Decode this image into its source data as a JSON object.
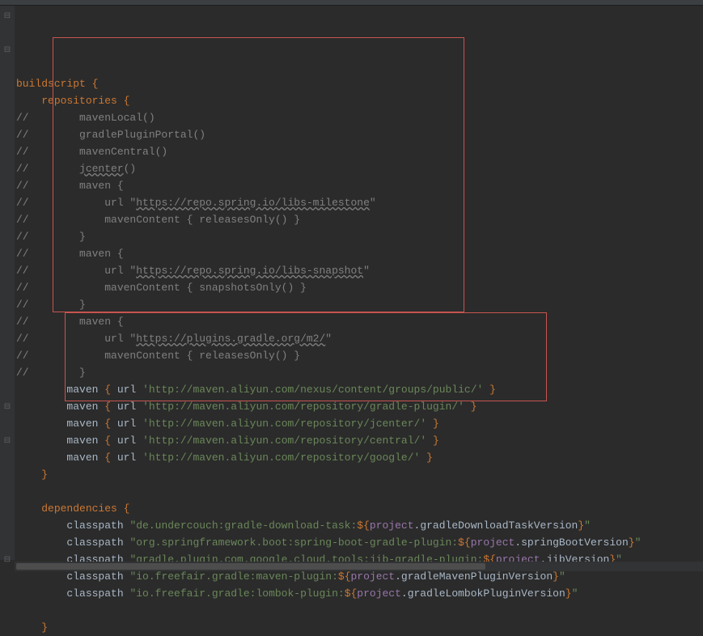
{
  "code": {
    "lines": [
      {
        "t": "code",
        "pre": "",
        "parts": [
          {
            "c": "keyword",
            "v": "buildscript"
          },
          {
            "c": "",
            "v": " "
          },
          {
            "c": "keyword",
            "v": "{"
          }
        ]
      },
      {
        "t": "code",
        "pre": "    ",
        "parts": [
          {
            "c": "keyword",
            "v": "repositories"
          },
          {
            "c": "",
            "v": " "
          },
          {
            "c": "keyword",
            "v": "{"
          }
        ]
      },
      {
        "t": "comment",
        "pre": "//        ",
        "parts": [
          {
            "c": "comment",
            "v": "mavenLocal()"
          }
        ]
      },
      {
        "t": "comment",
        "pre": "//        ",
        "parts": [
          {
            "c": "comment",
            "v": "gradlePluginPortal()"
          }
        ]
      },
      {
        "t": "comment",
        "pre": "//        ",
        "parts": [
          {
            "c": "comment",
            "v": "mavenCentral()"
          }
        ]
      },
      {
        "t": "comment",
        "pre": "//        ",
        "parts": [
          {
            "c": "comment wavy",
            "v": "jcenter"
          },
          {
            "c": "comment",
            "v": "()"
          }
        ]
      },
      {
        "t": "comment",
        "pre": "//        ",
        "parts": [
          {
            "c": "comment",
            "v": "maven {"
          }
        ]
      },
      {
        "t": "comment",
        "pre": "//            ",
        "parts": [
          {
            "c": "comment",
            "v": "url \""
          },
          {
            "c": "linkish",
            "v": "https://repo.spring.io/libs-milestone"
          },
          {
            "c": "comment",
            "v": "\""
          }
        ]
      },
      {
        "t": "comment",
        "pre": "//            ",
        "parts": [
          {
            "c": "comment",
            "v": "mavenContent { releasesOnly() }"
          }
        ]
      },
      {
        "t": "comment",
        "pre": "//        ",
        "parts": [
          {
            "c": "comment",
            "v": "}"
          }
        ]
      },
      {
        "t": "comment",
        "pre": "//        ",
        "parts": [
          {
            "c": "comment",
            "v": "maven {"
          }
        ]
      },
      {
        "t": "comment",
        "pre": "//            ",
        "parts": [
          {
            "c": "comment",
            "v": "url \""
          },
          {
            "c": "linkish",
            "v": "https://repo.spring.io/libs-snapshot"
          },
          {
            "c": "comment",
            "v": "\""
          }
        ]
      },
      {
        "t": "comment",
        "pre": "//            ",
        "parts": [
          {
            "c": "comment",
            "v": "mavenContent { snapshotsOnly() }"
          }
        ]
      },
      {
        "t": "comment",
        "pre": "//        ",
        "parts": [
          {
            "c": "comment",
            "v": "}"
          }
        ]
      },
      {
        "t": "comment",
        "pre": "//        ",
        "parts": [
          {
            "c": "comment",
            "v": "maven {"
          }
        ]
      },
      {
        "t": "comment",
        "pre": "//            ",
        "parts": [
          {
            "c": "comment",
            "v": "url \""
          },
          {
            "c": "linkish",
            "v": "https://plugins.gradle.org/m2/"
          },
          {
            "c": "comment",
            "v": "\""
          }
        ]
      },
      {
        "t": "comment",
        "pre": "//            ",
        "parts": [
          {
            "c": "comment",
            "v": "mavenContent { releasesOnly() }"
          }
        ]
      },
      {
        "t": "comment",
        "pre": "//        ",
        "parts": [
          {
            "c": "comment",
            "v": "}"
          }
        ]
      },
      {
        "t": "code",
        "pre": "        ",
        "parts": [
          {
            "c": "",
            "v": "maven "
          },
          {
            "c": "keyword",
            "v": "{"
          },
          {
            "c": "",
            "v": " url "
          },
          {
            "c": "string",
            "v": "'http://maven.aliyun.com/nexus/content/groups/public/'"
          },
          {
            "c": "",
            "v": " "
          },
          {
            "c": "keyword",
            "v": "}"
          }
        ]
      },
      {
        "t": "code",
        "pre": "        ",
        "parts": [
          {
            "c": "",
            "v": "maven "
          },
          {
            "c": "keyword",
            "v": "{"
          },
          {
            "c": "",
            "v": " url "
          },
          {
            "c": "string",
            "v": "'http://maven.aliyun.com/repository/gradle-plugin/'"
          },
          {
            "c": "",
            "v": " "
          },
          {
            "c": "keyword",
            "v": "}"
          }
        ]
      },
      {
        "t": "code",
        "pre": "        ",
        "parts": [
          {
            "c": "",
            "v": "maven "
          },
          {
            "c": "keyword",
            "v": "{"
          },
          {
            "c": "",
            "v": " url "
          },
          {
            "c": "string",
            "v": "'http://maven.aliyun.com/repository/jcenter/'"
          },
          {
            "c": "",
            "v": " "
          },
          {
            "c": "keyword",
            "v": "}"
          }
        ]
      },
      {
        "t": "code",
        "pre": "        ",
        "parts": [
          {
            "c": "",
            "v": "maven "
          },
          {
            "c": "keyword",
            "v": "{"
          },
          {
            "c": "",
            "v": " url "
          },
          {
            "c": "string",
            "v": "'http://maven.aliyun.com/repository/central/'"
          },
          {
            "c": "",
            "v": " "
          },
          {
            "c": "keyword",
            "v": "}"
          }
        ]
      },
      {
        "t": "code",
        "pre": "        ",
        "parts": [
          {
            "c": "",
            "v": "maven "
          },
          {
            "c": "keyword",
            "v": "{"
          },
          {
            "c": "",
            "v": " url "
          },
          {
            "c": "string",
            "v": "'http://maven.aliyun.com/repository/google/'"
          },
          {
            "c": "",
            "v": " "
          },
          {
            "c": "keyword",
            "v": "}"
          }
        ]
      },
      {
        "t": "code",
        "pre": "    ",
        "parts": [
          {
            "c": "keyword",
            "v": "}"
          }
        ]
      },
      {
        "t": "empty",
        "pre": "",
        "parts": []
      },
      {
        "t": "code",
        "pre": "    ",
        "parts": [
          {
            "c": "keyword",
            "v": "dependencies"
          },
          {
            "c": "",
            "v": " "
          },
          {
            "c": "keyword",
            "v": "{"
          }
        ]
      },
      {
        "t": "code",
        "pre": "        ",
        "parts": [
          {
            "c": "",
            "v": "classpath "
          },
          {
            "c": "string",
            "v": "\"de.undercouch:gradle-download-task:"
          },
          {
            "c": "gsexpr",
            "v": "${"
          },
          {
            "c": "ident",
            "v": "project"
          },
          {
            "c": "",
            "v": ".gradleDownloadTaskVersion"
          },
          {
            "c": "gsexpr",
            "v": "}"
          },
          {
            "c": "string",
            "v": "\""
          }
        ]
      },
      {
        "t": "code",
        "pre": "        ",
        "parts": [
          {
            "c": "",
            "v": "classpath "
          },
          {
            "c": "string",
            "v": "\"org.springframework.boot:spring-boot-gradle-plugin:"
          },
          {
            "c": "gsexpr",
            "v": "${"
          },
          {
            "c": "ident",
            "v": "project"
          },
          {
            "c": "",
            "v": ".springBootVersion"
          },
          {
            "c": "gsexpr",
            "v": "}"
          },
          {
            "c": "string",
            "v": "\""
          }
        ]
      },
      {
        "t": "code",
        "pre": "        ",
        "parts": [
          {
            "c": "",
            "v": "classpath "
          },
          {
            "c": "string",
            "v": "\"gradle.plugin.com.google.cloud.tools:jib-gradle-plugin:"
          },
          {
            "c": "gsexpr",
            "v": "${"
          },
          {
            "c": "ident",
            "v": "project"
          },
          {
            "c": "",
            "v": ".jibVersion"
          },
          {
            "c": "gsexpr",
            "v": "}"
          },
          {
            "c": "string",
            "v": "\""
          }
        ]
      },
      {
        "t": "code",
        "pre": "        ",
        "parts": [
          {
            "c": "",
            "v": "classpath "
          },
          {
            "c": "string",
            "v": "\"io.freefair.gradle:maven-plugin:"
          },
          {
            "c": "gsexpr",
            "v": "${"
          },
          {
            "c": "ident",
            "v": "project"
          },
          {
            "c": "",
            "v": ".gradleMavenPluginVersion"
          },
          {
            "c": "gsexpr",
            "v": "}"
          },
          {
            "c": "string",
            "v": "\""
          }
        ]
      },
      {
        "t": "code",
        "pre": "        ",
        "parts": [
          {
            "c": "",
            "v": "classpath "
          },
          {
            "c": "string",
            "v": "\"io.freefair.gradle:lombok-plugin:"
          },
          {
            "c": "gsexpr",
            "v": "${"
          },
          {
            "c": "ident",
            "v": "project"
          },
          {
            "c": "",
            "v": ".gradleLombokPluginVersion"
          },
          {
            "c": "gsexpr",
            "v": "}"
          },
          {
            "c": "string",
            "v": "\""
          }
        ]
      },
      {
        "t": "empty",
        "pre": "",
        "parts": []
      },
      {
        "t": "code",
        "pre": "    ",
        "parts": [
          {
            "c": "keyword",
            "v": "}"
          }
        ]
      }
    ]
  },
  "gutter": [
    "⊟",
    "",
    "⊟",
    "",
    "",
    "",
    "",
    "",
    "",
    "",
    "",
    "",
    "",
    "",
    "",
    "",
    "",
    "",
    "",
    "",
    "",
    "",
    "",
    "⊟",
    "",
    "⊟",
    "",
    "",
    "",
    "",
    "",
    "",
    "⊟"
  ]
}
